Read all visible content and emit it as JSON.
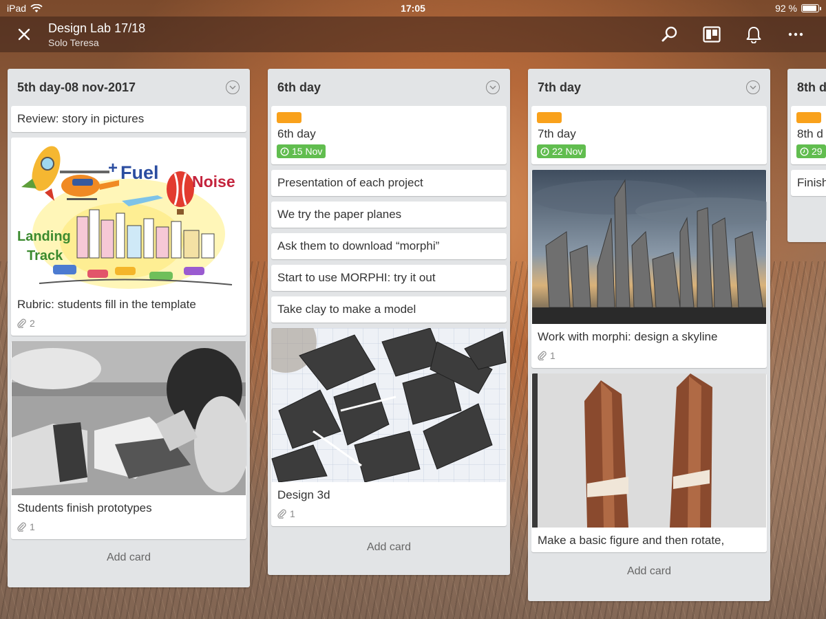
{
  "status": {
    "device": "iPad",
    "time": "17:05",
    "battery": "92 %",
    "battery_level": 0.92
  },
  "header": {
    "title": "Design Lab 17/18",
    "subtitle": "Solo Teresa"
  },
  "icons": {
    "close": "close-icon",
    "search": "search-icon",
    "board_view": "board-view-icon",
    "notifications": "bell-icon",
    "more": "more-icon"
  },
  "colors": {
    "label_orange": "#f9a11b",
    "due_green": "#61bd4f",
    "list_bg": "#e2e4e6"
  },
  "lists": [
    {
      "title": "5th day-08 nov-2017",
      "cards": [
        {
          "title": "Review: story in pictures"
        },
        {
          "title": "Rubric: students fill in the template",
          "attachments": "2",
          "cover_words": [
            "Fuel",
            "Noise",
            "Landing",
            "Track"
          ]
        },
        {
          "title": "Students finish prototypes",
          "attachments": "1"
        }
      ],
      "add_card": "Add card"
    },
    {
      "title": "6th day",
      "cards": [
        {
          "title": "6th day",
          "due": "15 Nov"
        },
        {
          "title": "Presentation of each project"
        },
        {
          "title": "We try the paper planes"
        },
        {
          "title": "Ask them to download “morphi”"
        },
        {
          "title": "Start to use MORPHI: try it out"
        },
        {
          "title": "Take clay to make a model"
        },
        {
          "title": "Design 3d",
          "attachments": "1"
        }
      ],
      "add_card": "Add card"
    },
    {
      "title": "7th day",
      "cards": [
        {
          "title": "7th day",
          "due": "22 Nov"
        },
        {
          "title": "Work with morphi: design a skyline",
          "attachments": "1"
        },
        {
          "title": "Make a basic figure and then rotate,"
        }
      ],
      "add_card": "Add card"
    },
    {
      "title": "8th d",
      "cards": [
        {
          "due": "29"
        },
        {
          "title": "Finish"
        }
      ]
    }
  ]
}
